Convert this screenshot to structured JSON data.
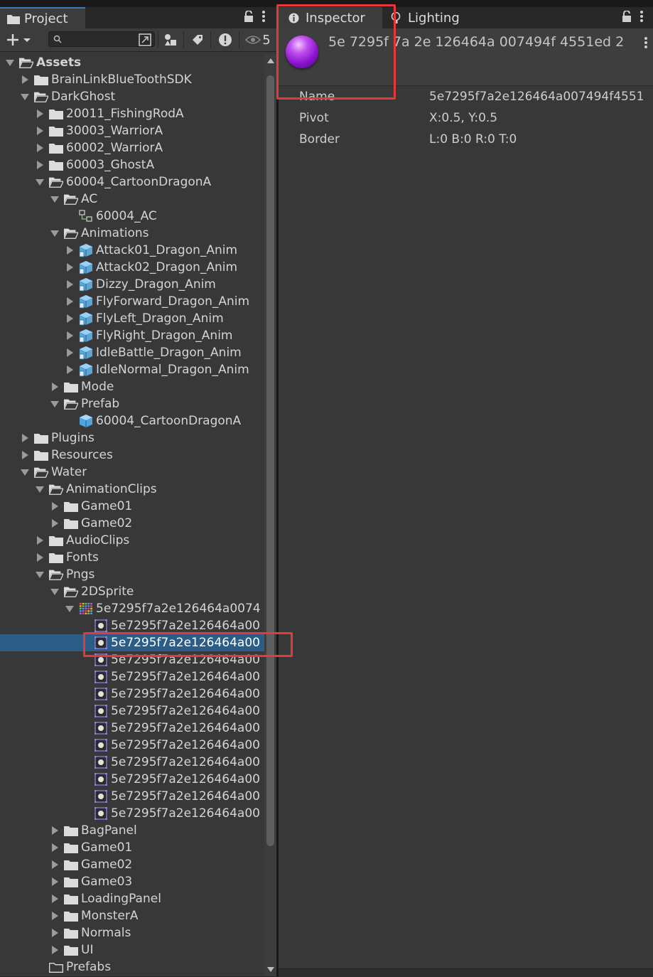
{
  "project_panel": {
    "tab_label": "Project",
    "visibility_count": "5",
    "tree": [
      {
        "label": "Assets",
        "depth": 0,
        "state": "open",
        "icon": "folder-open-icon",
        "bold": true
      },
      {
        "label": "BrainLinkBlueToothSDK",
        "depth": 1,
        "state": "closed",
        "icon": "folder-icon"
      },
      {
        "label": "DarkGhost",
        "depth": 1,
        "state": "open",
        "icon": "folder-open-icon"
      },
      {
        "label": "20011_FishingRodA",
        "depth": 2,
        "state": "closed",
        "icon": "folder-icon"
      },
      {
        "label": "30003_WarriorA",
        "depth": 2,
        "state": "closed",
        "icon": "folder-icon"
      },
      {
        "label": "60002_WarriorA",
        "depth": 2,
        "state": "closed",
        "icon": "folder-icon"
      },
      {
        "label": "60003_GhostA",
        "depth": 2,
        "state": "closed",
        "icon": "folder-icon"
      },
      {
        "label": "60004_CartoonDragonA",
        "depth": 2,
        "state": "open",
        "icon": "folder-open-icon"
      },
      {
        "label": "AC",
        "depth": 3,
        "state": "open",
        "icon": "folder-open-icon"
      },
      {
        "label": "60004_AC",
        "depth": 4,
        "state": "none",
        "icon": "animator-controller-icon"
      },
      {
        "label": "Animations",
        "depth": 3,
        "state": "open",
        "icon": "folder-open-icon"
      },
      {
        "label": "Attack01_Dragon_Anim",
        "depth": 4,
        "state": "closed",
        "icon": "model-icon"
      },
      {
        "label": "Attack02_Dragon_Anim",
        "depth": 4,
        "state": "closed",
        "icon": "model-icon"
      },
      {
        "label": "Dizzy_Dragon_Anim",
        "depth": 4,
        "state": "closed",
        "icon": "model-icon"
      },
      {
        "label": "FlyForward_Dragon_Anim",
        "depth": 4,
        "state": "closed",
        "icon": "model-icon"
      },
      {
        "label": "FlyLeft_Dragon_Anim",
        "depth": 4,
        "state": "closed",
        "icon": "model-icon"
      },
      {
        "label": "FlyRight_Dragon_Anim",
        "depth": 4,
        "state": "closed",
        "icon": "model-icon"
      },
      {
        "label": "IdleBattle_Dragon_Anim",
        "depth": 4,
        "state": "closed",
        "icon": "model-icon"
      },
      {
        "label": "IdleNormal_Dragon_Anim",
        "depth": 4,
        "state": "closed",
        "icon": "model-icon"
      },
      {
        "label": "Mode",
        "depth": 3,
        "state": "closed",
        "icon": "folder-icon"
      },
      {
        "label": "Prefab",
        "depth": 3,
        "state": "open",
        "icon": "folder-open-icon"
      },
      {
        "label": "60004_CartoonDragonA",
        "depth": 4,
        "state": "none",
        "icon": "prefab-icon"
      },
      {
        "label": "Plugins",
        "depth": 1,
        "state": "closed",
        "icon": "folder-icon"
      },
      {
        "label": "Resources",
        "depth": 1,
        "state": "closed",
        "icon": "folder-icon"
      },
      {
        "label": "Water",
        "depth": 1,
        "state": "open",
        "icon": "folder-open-icon"
      },
      {
        "label": "AnimationClips",
        "depth": 2,
        "state": "open",
        "icon": "folder-open-icon"
      },
      {
        "label": "Game01",
        "depth": 3,
        "state": "closed",
        "icon": "folder-icon"
      },
      {
        "label": "Game02",
        "depth": 3,
        "state": "closed",
        "icon": "folder-icon"
      },
      {
        "label": "AudioClips",
        "depth": 2,
        "state": "closed",
        "icon": "folder-icon"
      },
      {
        "label": "Fonts",
        "depth": 2,
        "state": "closed",
        "icon": "folder-icon"
      },
      {
        "label": "Pngs",
        "depth": 2,
        "state": "open",
        "icon": "folder-open-icon"
      },
      {
        "label": "2DSprite",
        "depth": 3,
        "state": "open",
        "icon": "folder-open-icon"
      },
      {
        "label": "5e7295f7a2e126464a0074",
        "depth": 4,
        "state": "open",
        "icon": "sprite-sheet-icon"
      },
      {
        "label": "5e7295f7a2e126464a00",
        "depth": 5,
        "state": "none",
        "icon": "sprite-icon"
      },
      {
        "label": "5e7295f7a2e126464a00",
        "depth": 5,
        "state": "none",
        "icon": "sprite-icon",
        "selected": true
      },
      {
        "label": "5e7295f7a2e126464a00",
        "depth": 5,
        "state": "none",
        "icon": "sprite-icon"
      },
      {
        "label": "5e7295f7a2e126464a00",
        "depth": 5,
        "state": "none",
        "icon": "sprite-icon"
      },
      {
        "label": "5e7295f7a2e126464a00",
        "depth": 5,
        "state": "none",
        "icon": "sprite-icon"
      },
      {
        "label": "5e7295f7a2e126464a00",
        "depth": 5,
        "state": "none",
        "icon": "sprite-icon"
      },
      {
        "label": "5e7295f7a2e126464a00",
        "depth": 5,
        "state": "none",
        "icon": "sprite-icon"
      },
      {
        "label": "5e7295f7a2e126464a00",
        "depth": 5,
        "state": "none",
        "icon": "sprite-icon"
      },
      {
        "label": "5e7295f7a2e126464a00",
        "depth": 5,
        "state": "none",
        "icon": "sprite-icon"
      },
      {
        "label": "5e7295f7a2e126464a00",
        "depth": 5,
        "state": "none",
        "icon": "sprite-icon"
      },
      {
        "label": "5e7295f7a2e126464a00",
        "depth": 5,
        "state": "none",
        "icon": "sprite-icon"
      },
      {
        "label": "5e7295f7a2e126464a00",
        "depth": 5,
        "state": "none",
        "icon": "sprite-icon"
      },
      {
        "label": "BagPanel",
        "depth": 3,
        "state": "closed",
        "icon": "folder-icon"
      },
      {
        "label": "Game01",
        "depth": 3,
        "state": "closed",
        "icon": "folder-icon"
      },
      {
        "label": "Game02",
        "depth": 3,
        "state": "closed",
        "icon": "folder-icon"
      },
      {
        "label": "Game03",
        "depth": 3,
        "state": "closed",
        "icon": "folder-icon"
      },
      {
        "label": "LoadingPanel",
        "depth": 3,
        "state": "closed",
        "icon": "folder-icon"
      },
      {
        "label": "MonsterA",
        "depth": 3,
        "state": "closed",
        "icon": "folder-icon"
      },
      {
        "label": "Normals",
        "depth": 3,
        "state": "closed",
        "icon": "folder-icon"
      },
      {
        "label": "UI",
        "depth": 3,
        "state": "closed",
        "icon": "folder-icon"
      },
      {
        "label": "Prefabs",
        "depth": 2,
        "state": "none",
        "icon": "folder-empty-icon"
      }
    ]
  },
  "inspector_panel": {
    "tab_label": "Inspector",
    "second_tab_label": "Lighting",
    "asset_title": "5e 7295f 7a 2e 126464a 007494f 4551ed 2",
    "properties": [
      {
        "name": "Name",
        "value": "5e7295f7a2e126464a007494f4551"
      },
      {
        "name": "Pivot",
        "value": "X:0.5, Y:0.5"
      },
      {
        "name": "Border",
        "value": "L:0 B:0 R:0 T:0"
      }
    ]
  },
  "colors": {
    "panel_bg": "#383838",
    "selection": "#2c5d87",
    "highlight_box": "#e5383b",
    "sprite_purple": "#8a12cc"
  }
}
